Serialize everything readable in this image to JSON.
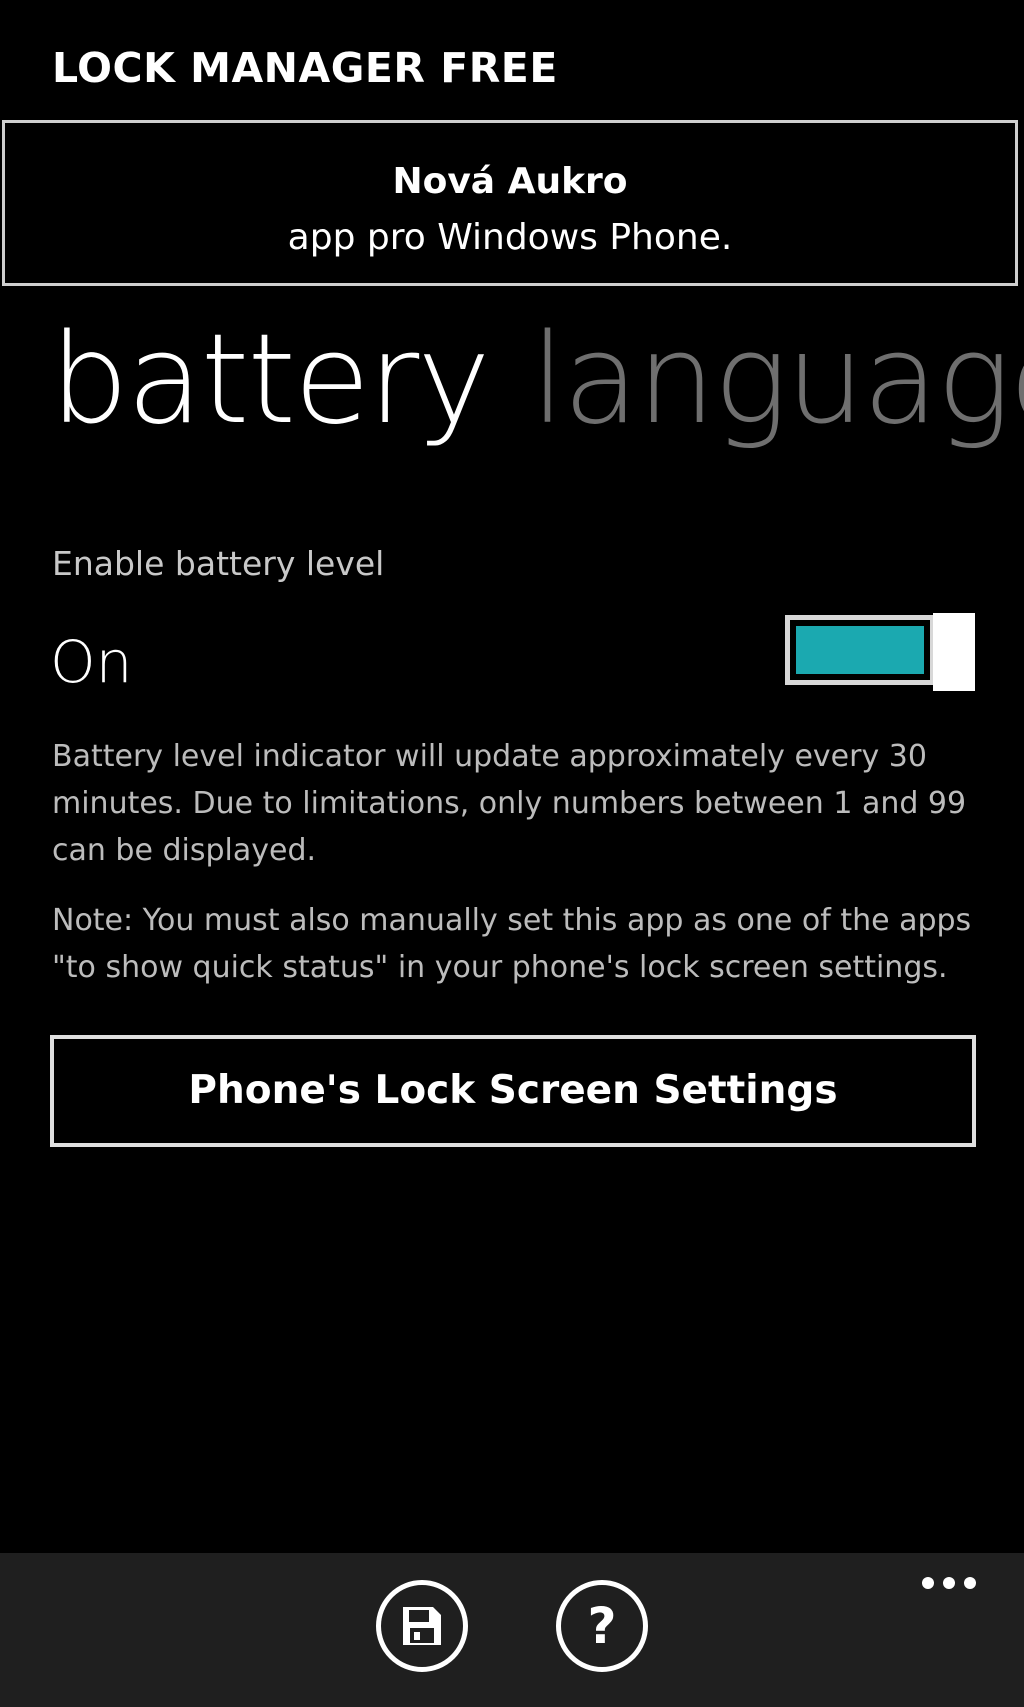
{
  "app": {
    "title": "LOCK MANAGER FREE"
  },
  "ad_banner": {
    "line1": "Nová Aukro",
    "line2": "app pro Windows Phone."
  },
  "pivot": {
    "active_tab": "battery",
    "next_tab": "language"
  },
  "battery": {
    "setting_label": "Enable battery level",
    "toggle_state": "On",
    "toggle_on": true,
    "description": "Battery level indicator will update approximately every 30 minutes. Due to limitations, only numbers between 1 and 99 can be displayed.",
    "note": "Note: You must also manually set this app as one of the apps \"to show quick status\" in your phone's lock screen settings.",
    "lock_screen_button": "Phone's Lock Screen Settings"
  },
  "app_bar": {
    "buttons": [
      {
        "icon": "save-icon"
      },
      {
        "icon": "help-icon"
      }
    ],
    "more_icon": "ellipsis-icon"
  },
  "colors": {
    "accent": "#1ba9b0",
    "background": "#000000",
    "app_bar": "#1f1f1f",
    "inactive_text": "#6f6f6f"
  }
}
